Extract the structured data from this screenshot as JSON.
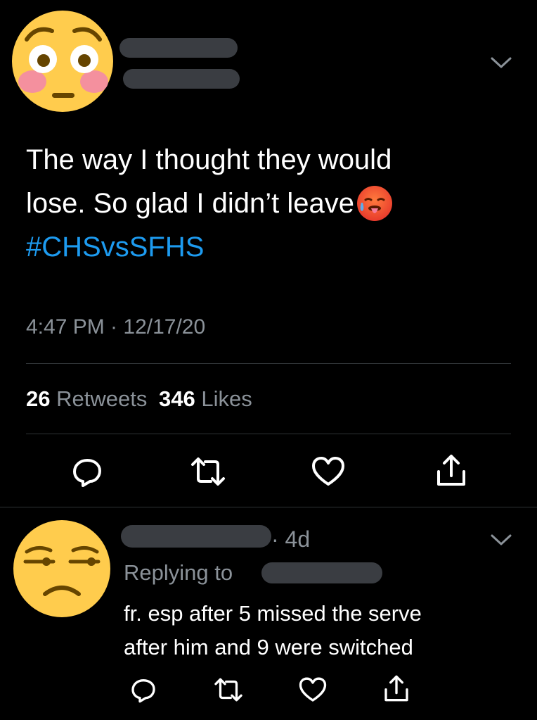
{
  "tweet": {
    "avatar_icon": "flushed-face-emoji",
    "text_line1": "The way I thought they would",
    "text_line2": "lose. So glad I didn’t leave",
    "inline_emoji": "hot-face-emoji",
    "hashtag": "#CHSvsSFHS",
    "timestamp": "4:47 PM · 12/17/20",
    "retweets_count": "26",
    "retweets_label": "Retweets",
    "likes_count": "346",
    "likes_label": "Likes"
  },
  "reply": {
    "avatar_icon": "unamused-face-emoji",
    "age": "· 4d",
    "replying_to": "Replying to",
    "text_line1": "fr. esp after 5 missed the serve",
    "text_line2": "after him and 9 were switched"
  },
  "colors": {
    "background": "#000000",
    "link": "#1d9bf0",
    "secondary": "#8b9299",
    "redaction": "#3a3d42"
  }
}
